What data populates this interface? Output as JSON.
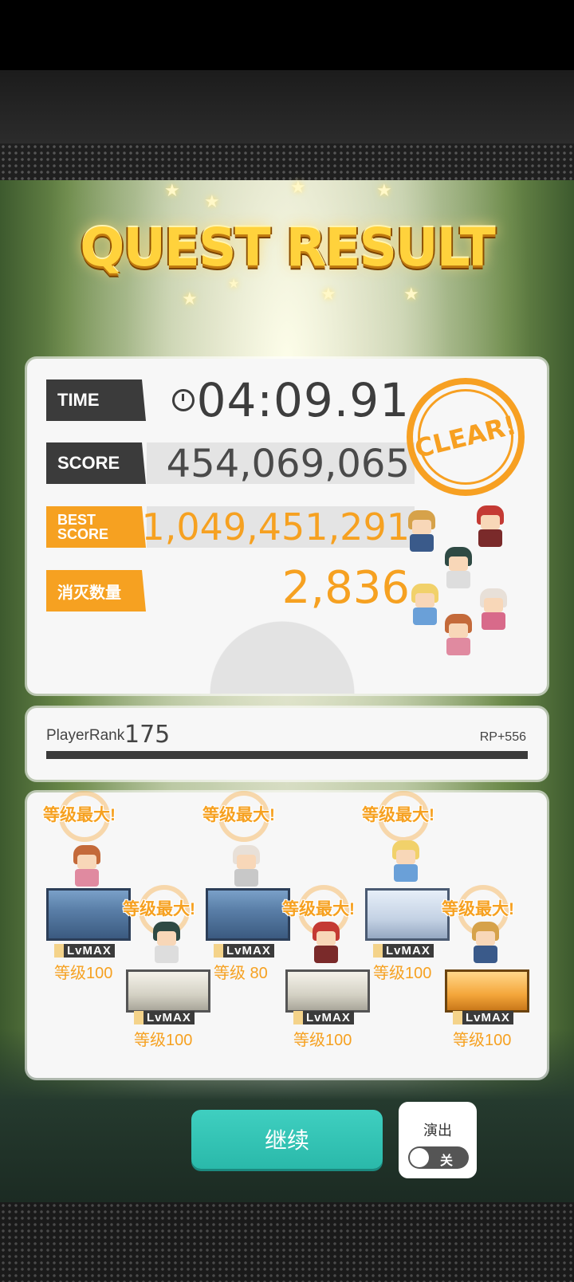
{
  "title": "QUEST RESULT",
  "result": {
    "time_label": "TIME",
    "time_value": "04:09.91",
    "score_label": "SCORE",
    "score_value": "454,069,065",
    "best_label_line1": "BEST",
    "best_label_line2": "SCORE",
    "best_value": "1,049,451,291",
    "kill_label": "消灭数量",
    "kill_value": "2,836",
    "clear_stamp": "CLEAR!"
  },
  "player": {
    "rank_label": "PlayerRank",
    "rank_value": "175",
    "rp": "RP+556"
  },
  "party": [
    {
      "max_label": "等级最大!",
      "lv_tag": "LvMAX",
      "level": "等级100"
    },
    {
      "max_label": "等级最大!",
      "lv_tag": "LvMAX",
      "level": "等级100"
    },
    {
      "max_label": "等级最大!",
      "lv_tag": "LvMAX",
      "level": "等级 80"
    },
    {
      "max_label": "等级最大!",
      "lv_tag": "LvMAX",
      "level": "等级100"
    },
    {
      "max_label": "等级最大!",
      "lv_tag": "LvMAX",
      "level": "等级100"
    },
    {
      "max_label": "等级最大!",
      "lv_tag": "LvMAX",
      "level": "等级100"
    }
  ],
  "controls": {
    "continue_label": "继续",
    "performance_label": "演出",
    "toggle_state": "关"
  },
  "colors": {
    "accent_orange": "#f6a121",
    "title_gold": "#ffd23c",
    "continue_teal": "#2ab9aa",
    "tag_dark": "#3b3b3b"
  }
}
